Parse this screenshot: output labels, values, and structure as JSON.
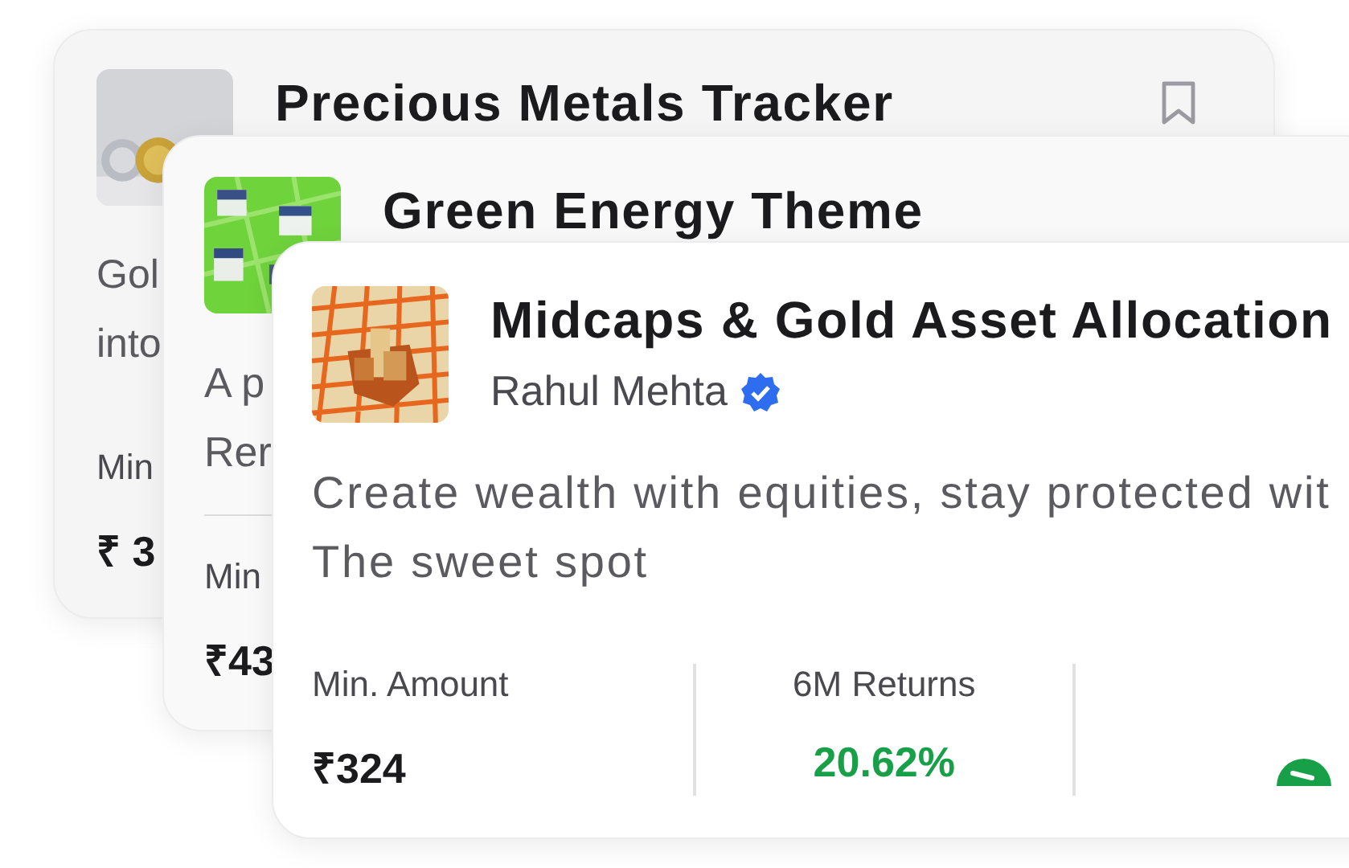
{
  "cards": [
    {
      "title": "Precious Metals Tracker",
      "bookmark": false,
      "description": [
        "Gol",
        "into"
      ],
      "stats": [
        {
          "kind": "text",
          "label": "Min",
          "value": "₹ 3",
          "positive": false
        }
      ]
    },
    {
      "title": "Green Energy Theme",
      "description": [
        "A p",
        "Rer"
      ],
      "stats": [
        {
          "kind": "text",
          "label": "Min",
          "value": "₹43",
          "positive": false
        }
      ]
    },
    {
      "title": "Midcaps & Gold Asset Allocation",
      "author": "Rahul Mehta",
      "verified": true,
      "description": [
        "Create wealth with equities, stay protected wit",
        "The sweet spot"
      ],
      "stats": [
        {
          "kind": "text",
          "label": "Min. Amount",
          "value": "₹324",
          "positive": false
        },
        {
          "kind": "text",
          "label": "6M Returns",
          "value": "20.62%",
          "positive": true
        },
        {
          "kind": "icon"
        }
      ]
    }
  ]
}
